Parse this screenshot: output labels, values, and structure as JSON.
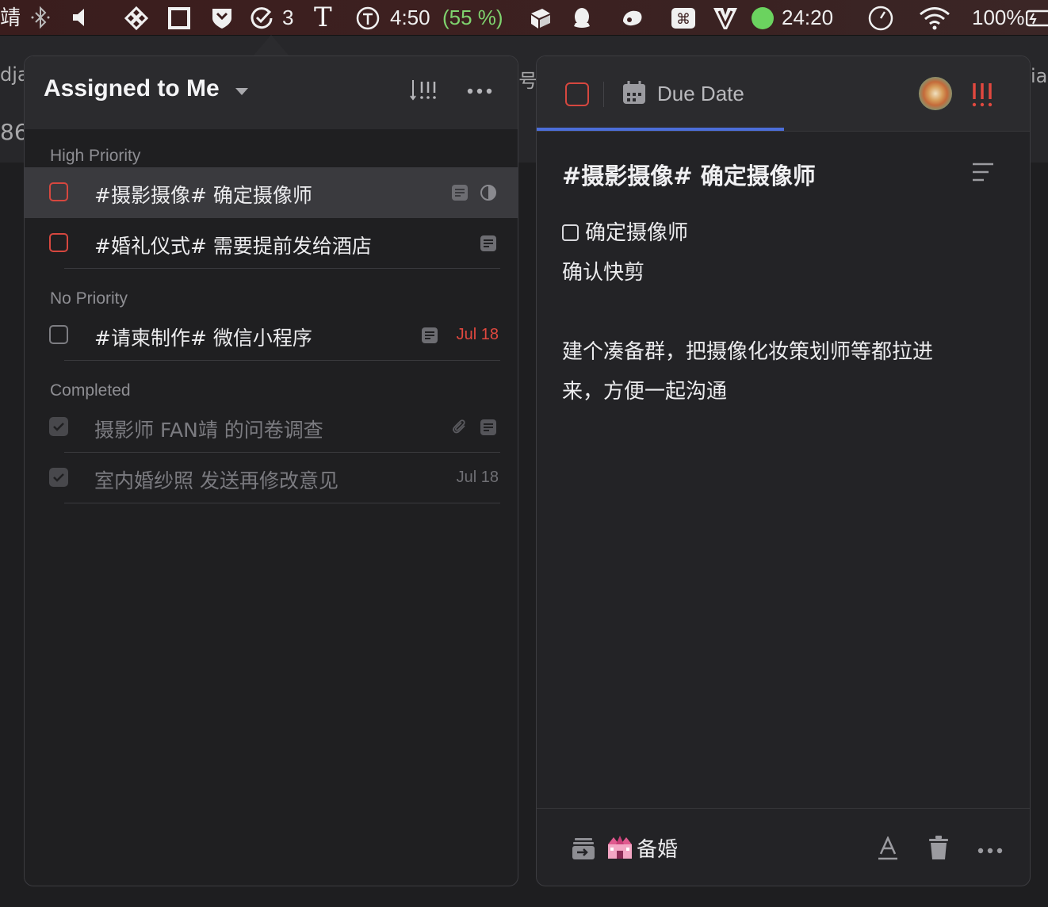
{
  "menubar": {
    "left_char": "靖",
    "badge_count": "3",
    "t_glyph": "T",
    "timer_time": "4:50",
    "timer_pct": "(55 %)",
    "countdown": "24:20",
    "battery": "100%"
  },
  "background_app": {
    "tab1": "dja",
    "tab1_sub": "86",
    "tab2": "号!",
    "tab3": "ia"
  },
  "list_panel": {
    "title": "Assigned to Me",
    "sections": {
      "high": "High Priority",
      "none": "No Priority",
      "completed": "Completed"
    },
    "tasks": [
      {
        "title": "#摄影摄像# 确定摄像师",
        "date": ""
      },
      {
        "title": "#婚礼仪式# 需要提前发给酒店",
        "date": ""
      },
      {
        "title": "#请柬制作# 微信小程序",
        "date": "Jul 18"
      },
      {
        "title": "摄影师 FAN靖 的问卷调查",
        "date": ""
      },
      {
        "title": "室内婚纱照 发送再修改意见",
        "date": "Jul 18"
      }
    ]
  },
  "detail_panel": {
    "due_label": "Due Date",
    "title": "#摄影摄像# 确定摄像师",
    "checklist_item": "确定摄像师",
    "body_lines": [
      "确认快剪",
      "建个凑备群，把摄像化妆策划师等都拉进",
      "来，方便一起沟通"
    ],
    "list_name": "备婚"
  },
  "colors": {
    "priority_red": "#d6473f",
    "accent_blue": "#4c6ed9",
    "date_red": "#e0483f",
    "timer_green": "#7fd36e"
  },
  "icons": [
    "bluetooth-icon",
    "volume-icon",
    "app-icon",
    "window-icon",
    "shield-icon",
    "ticktick-icon",
    "typora-icon",
    "timer-icon",
    "cube-icon",
    "qq-icon",
    "cloud-icon",
    "command-icon",
    "vim-icon",
    "clock-icon",
    "wifi-icon",
    "battery-icon",
    "sort-icon",
    "more-icon",
    "note-icon",
    "half-circle-icon",
    "attachment-icon",
    "calendar-icon",
    "priority-icon",
    "description-icon",
    "move-icon",
    "font-icon",
    "trash-icon"
  ]
}
